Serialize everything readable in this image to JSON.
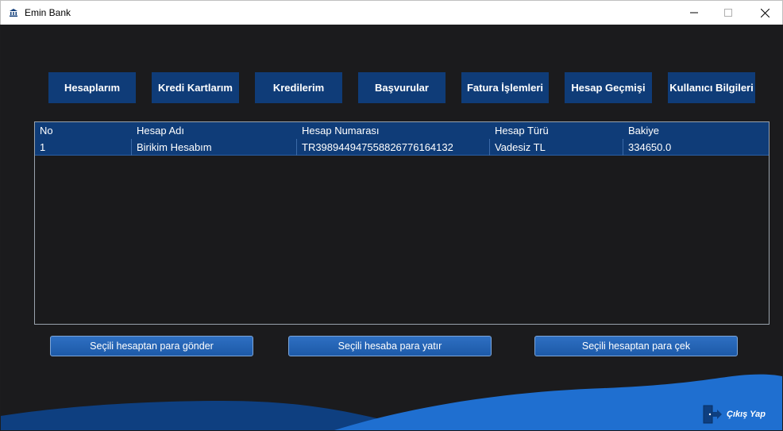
{
  "window": {
    "title": "Emin Bank",
    "icon": "bank-icon",
    "controls": [
      "minimize-icon",
      "maximize-icon",
      "close-icon"
    ]
  },
  "nav": {
    "items": [
      {
        "label": "Hesaplarım"
      },
      {
        "label": "Kredi Kartlarım"
      },
      {
        "label": "Kredilerim"
      },
      {
        "label": "Başvurular"
      },
      {
        "label": "Fatura İşlemleri"
      },
      {
        "label": "Hesap Geçmişi"
      },
      {
        "label": "Kullanıcı Bilgileri"
      }
    ]
  },
  "table": {
    "columns": [
      "No",
      "Hesap Adı",
      "Hesap Numarası",
      "Hesap Türü",
      "Bakiye"
    ],
    "rows": [
      [
        "1",
        "Birikim Hesabım",
        "TR398944947558826776164132",
        "Vadesiz TL",
        "334650.0"
      ]
    ]
  },
  "actions": {
    "send": "Seçili hesaptan para gönder",
    "deposit": "Seçili hesaba para yatır",
    "withdraw": "Seçili hesaptan para çek"
  },
  "logout": {
    "label": "Çıkış Yap",
    "icon": "logout-door-icon"
  },
  "colors": {
    "background": "#1b1b1d",
    "accent": "#0f3c78",
    "button": "#2466b8",
    "wave_light": "#1f6fd0",
    "wave_dark": "#0e3f80"
  }
}
